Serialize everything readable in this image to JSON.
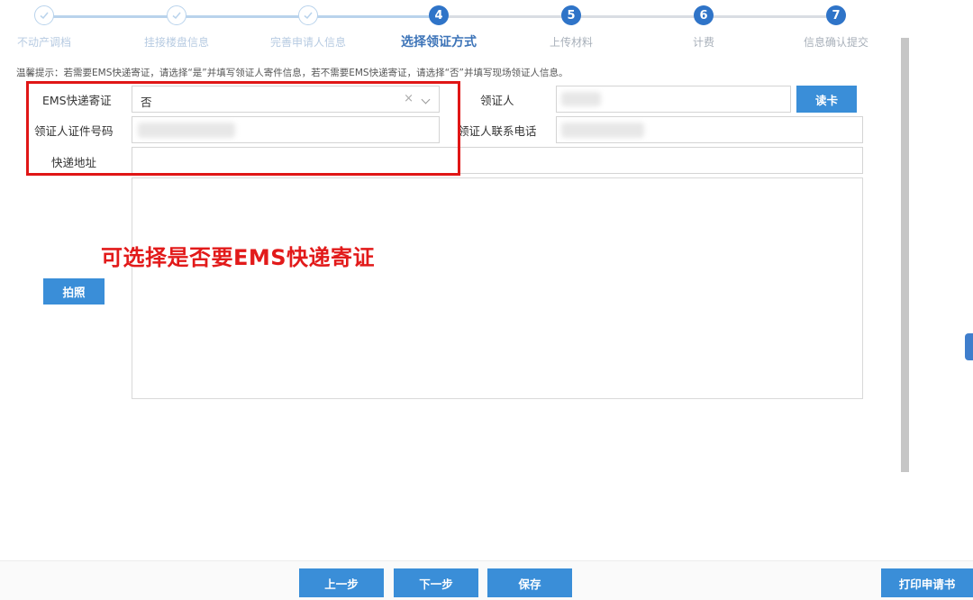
{
  "stepper": {
    "steps": [
      {
        "label": "不动产调档",
        "state": "done"
      },
      {
        "label": "挂接楼盘信息",
        "state": "done"
      },
      {
        "label": "完善申请人信息",
        "state": "done"
      },
      {
        "label": "选择领证方式",
        "state": "active",
        "num": "4"
      },
      {
        "label": "上传材料",
        "state": "todo",
        "num": "5"
      },
      {
        "label": "计费",
        "state": "todo",
        "num": "6"
      },
      {
        "label": "信息确认提交",
        "state": "todo",
        "num": "7"
      }
    ]
  },
  "hint": "温馨提示：若需要EMS快递寄证，请选择“是”并填写领证人寄件信息，若不需要EMS快递寄证，请选择“否”并填写现场领证人信息。",
  "form": {
    "ems_label": "EMS快递寄证",
    "ems_value": "否",
    "recipient_label": "领证人",
    "read_card_button": "读卡",
    "id_number_label": "领证人证件号码",
    "phone_label": "领证人联系电话",
    "address_label": "快递地址"
  },
  "photo_button": "拍照",
  "annotation": "可选择是否要EMS快递寄证",
  "footer": {
    "prev": "上一步",
    "next": "下一步",
    "save": "保存",
    "print": "打印申请书"
  },
  "colors": {
    "accent": "#2f74c8",
    "button": "#3a8ed8",
    "annotation_red": "#e21a1a"
  }
}
